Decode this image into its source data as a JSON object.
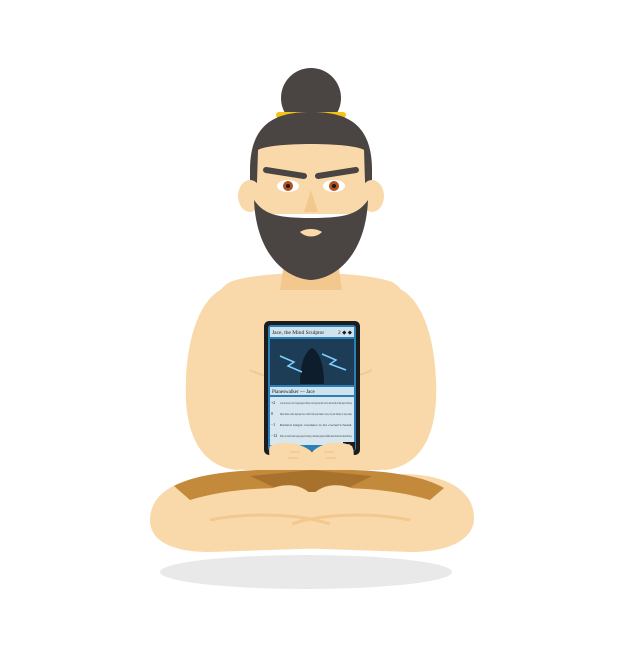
{
  "card": {
    "name": "Jace, the Mind Sculptor",
    "mana_cost": "2 ◆ ◆",
    "type_line": "Planeswalker — Jace",
    "loyalty": "3",
    "abilities": [
      {
        "cost": "+2",
        "text": "Look at the top card of target player's library. You may put that card on the bottom of that player's library."
      },
      {
        "cost": "0",
        "text": "Draw three cards, then put two cards from your hand on top of your library in any order."
      },
      {
        "cost": "−1",
        "text": "Return target creature to its owner's hand."
      },
      {
        "cost": "−12",
        "text": "Exile all cards from target player's library, then that player shuffles their hand into their library."
      }
    ]
  },
  "colors": {
    "skin": "#f9d9aa",
    "skin_shadow": "#f2c88f",
    "hair": "#4a4542",
    "hair_band": "#f3c317",
    "cloth": "#c48a3c",
    "cloth_dark": "#a9722c",
    "iris": "#b0521f",
    "card_frame": "#1d1d1d",
    "card_blue": "#2b7fb8",
    "ground_shadow": "#e9e9e9"
  }
}
